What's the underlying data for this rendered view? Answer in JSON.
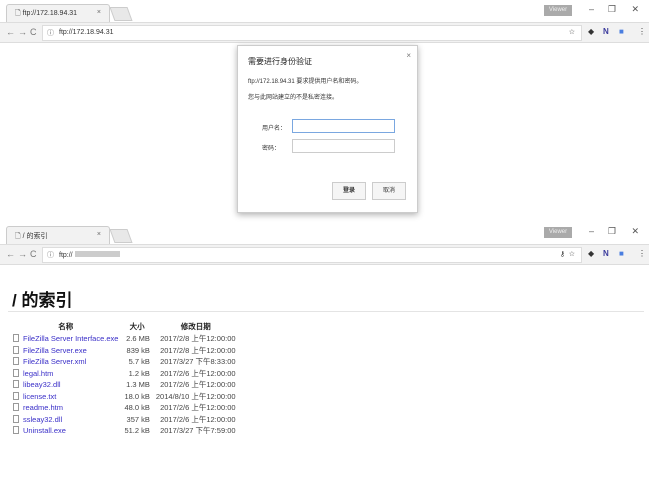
{
  "window1": {
    "tab_title": "ftp://172.18.94.31",
    "profile": "Viewer",
    "url": "ftp://172.18.94.31"
  },
  "dialog": {
    "title": "需要进行身份验证",
    "message1": "ftp://172.18.94.31 要求提供用户名和密码。",
    "message2": "您与此网站建立的不是私密连接。",
    "username_label": "用户名：",
    "username_value": "",
    "password_label": "密码：",
    "password_value": "",
    "login": "登录",
    "cancel": "取消",
    "close": "×"
  },
  "window2": {
    "tab_title": "/ 的索引",
    "profile": "Viewer",
    "url": "ftp://"
  },
  "page": {
    "title": "/ 的索引",
    "headers": {
      "name": "名称",
      "size": "大小",
      "date": "修改日期"
    },
    "files": [
      {
        "name": "FileZilla Server Interface.exe",
        "size": "2.6 MB",
        "date": "2017/2/8 上午12:00:00"
      },
      {
        "name": "FileZilla Server.exe",
        "size": "839 kB",
        "date": "2017/2/8 上午12:00:00"
      },
      {
        "name": "FileZilla Server.xml",
        "size": "5.7 kB",
        "date": "2017/3/27 下午8:33:00"
      },
      {
        "name": "legal.htm",
        "size": "1.2 kB",
        "date": "2017/2/6 上午12:00:00"
      },
      {
        "name": "libeay32.dll",
        "size": "1.3 MB",
        "date": "2017/2/6 上午12:00:00"
      },
      {
        "name": "license.txt",
        "size": "18.0 kB",
        "date": "2014/8/10 上午12:00:00"
      },
      {
        "name": "readme.htm",
        "size": "48.0 kB",
        "date": "2017/2/6 上午12:00:00"
      },
      {
        "name": "ssleay32.dll",
        "size": "357 kB",
        "date": "2017/2/6 上午12:00:00"
      },
      {
        "name": "Uninstall.exe",
        "size": "51.2 kB",
        "date": "2017/3/27 下午7:59:00"
      }
    ]
  }
}
